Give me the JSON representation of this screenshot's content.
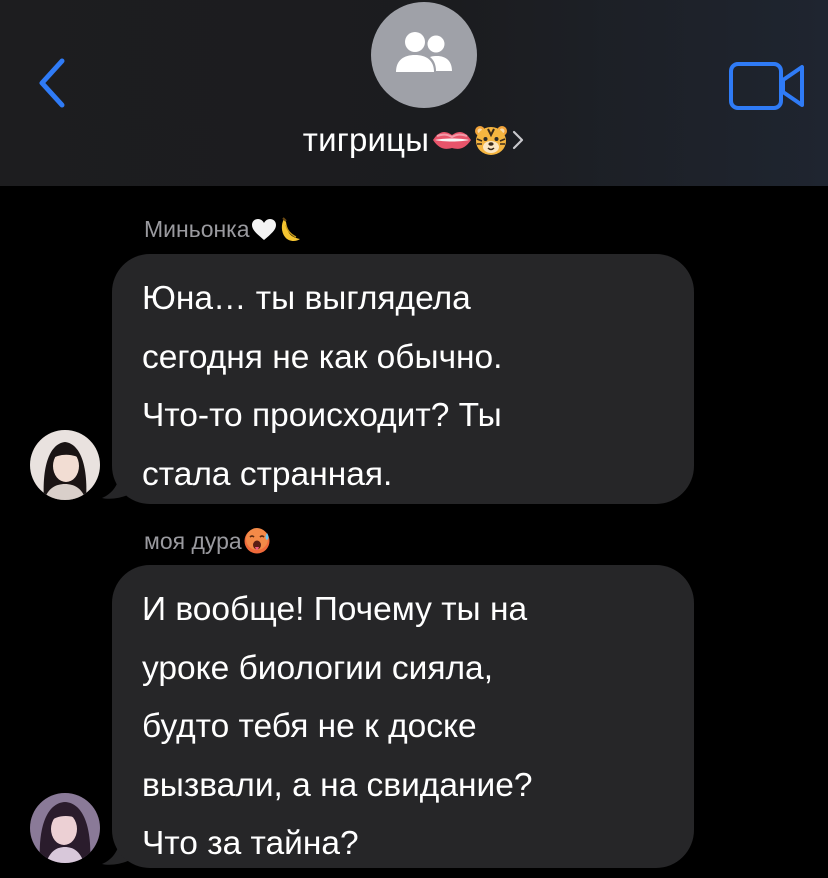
{
  "header": {
    "title": "тигрицы",
    "title_emoji_1": "lips-emoji",
    "title_emoji_2": "tiger-face-emoji",
    "chevron": "›",
    "back_icon": "chevron-left-icon",
    "video_icon": "video-camera-icon",
    "group_avatar_icon": "people-icon"
  },
  "messages": [
    {
      "sender": "Миньонка",
      "sender_emojis": [
        "white-heart-emoji",
        "banana-emoji"
      ],
      "lines": [
        "Юна… ты выглядела",
        "сегодня не как обычно.",
        "Что-то происходит? Ты",
        "стала странная."
      ]
    },
    {
      "sender": "моя дура",
      "sender_emojis": [
        "hot-face-emoji"
      ],
      "lines": [
        "И вообще! Почему ты на",
        "уроке биологии сияла,",
        "будто тебя не к доске",
        "вызвали, а на свидание?",
        "Что за тайна?"
      ]
    }
  ],
  "colors": {
    "accent": "#2f7bf6",
    "bubble": "#262628",
    "header_bg": "#1d1d1f",
    "sender_text": "#9a9a9f"
  }
}
